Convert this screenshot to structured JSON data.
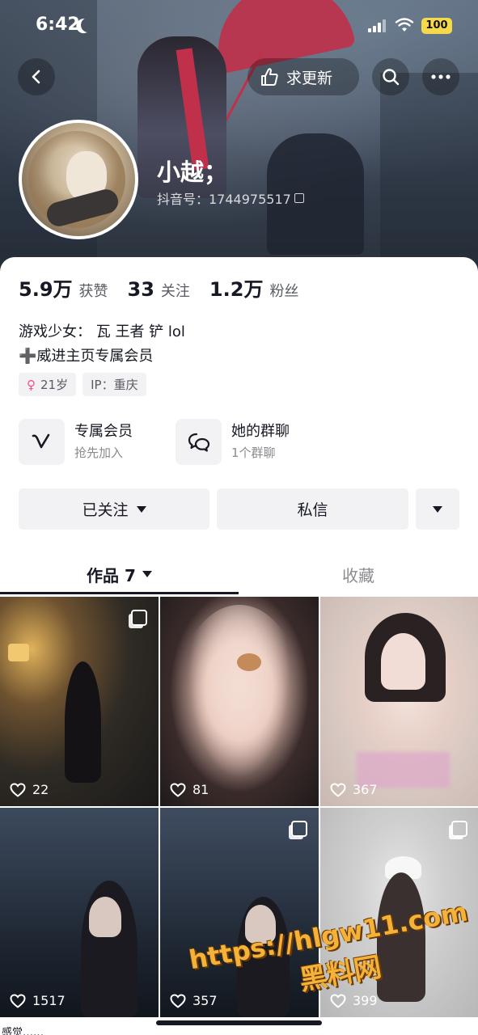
{
  "status_bar": {
    "time": "6:42",
    "battery": "100"
  },
  "header": {
    "update_button_label": "求更新",
    "nickname": "小越；",
    "douyin_id": "抖音号：1744975517"
  },
  "stats": [
    {
      "value": "5.9万",
      "label": "获赞"
    },
    {
      "value": "33",
      "label": "关注"
    },
    {
      "value": "1.2万",
      "label": "粉丝"
    }
  ],
  "bio": {
    "line1": "游戏少女： 瓦 王者 铲 lol",
    "line2": "➕威进主页专属会员"
  },
  "tags": {
    "age": "21岁",
    "ip": "IP：重庆"
  },
  "features": [
    {
      "title": "专属会员",
      "subtitle": "抢先加入"
    },
    {
      "title": "她的群聊",
      "subtitle": "1个群聊"
    }
  ],
  "actions": {
    "follow_label": "已关注",
    "message_label": "私信"
  },
  "tabs": {
    "works_label": "作品 7",
    "favorites_label": "收藏"
  },
  "videos": [
    {
      "likes": "22"
    },
    {
      "likes": "81"
    },
    {
      "likes": "367"
    },
    {
      "likes": "1517"
    },
    {
      "likes": "357"
    },
    {
      "likes": "399"
    }
  ],
  "watermark": {
    "url": "https://hlgw11.com",
    "name": "黑料网"
  },
  "caption_fragment": "感觉……"
}
